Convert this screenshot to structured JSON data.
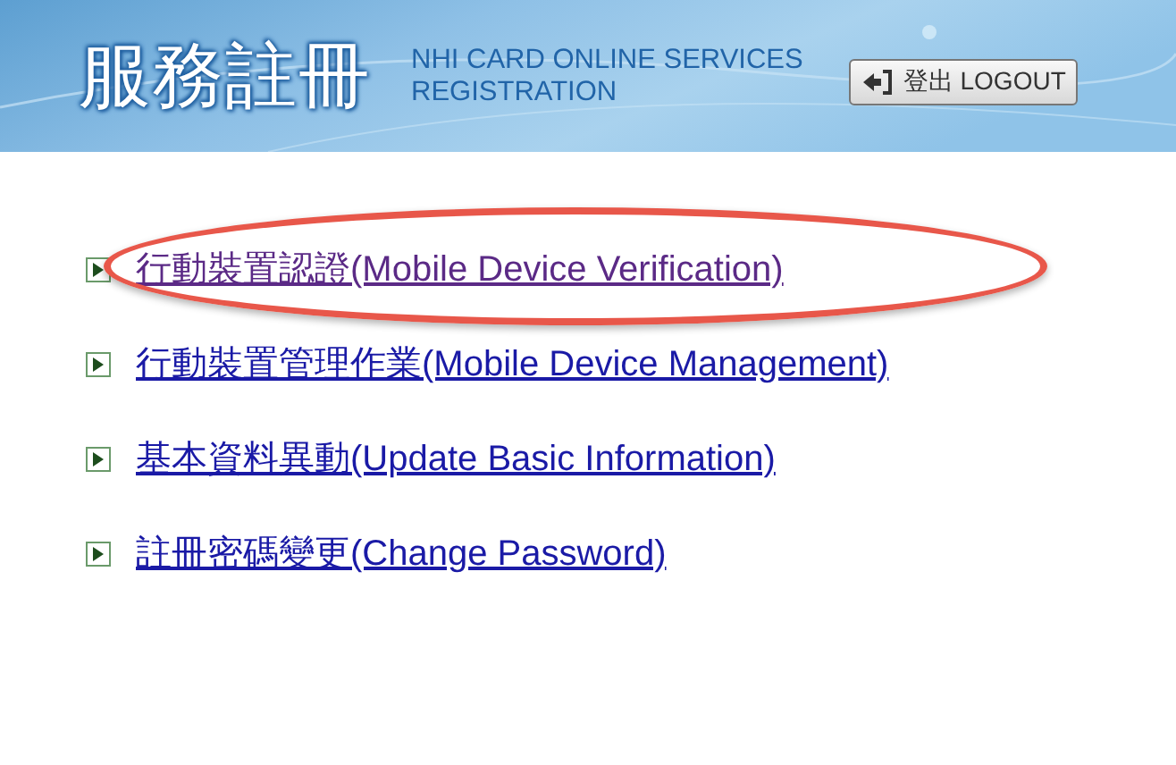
{
  "header": {
    "title": "服務註冊",
    "subtitle_lines": [
      "NHI CARD ONLINE SERVICES",
      "REGISTRATION"
    ],
    "logout_button": "登出 LOGOUT"
  },
  "links": [
    {
      "label": "行動裝置認證(Mobile Device Verification)",
      "visited": true,
      "circled": true
    },
    {
      "label": "行動裝置管理作業(Mobile Device Management)",
      "visited": false,
      "circled": false
    },
    {
      "label": "基本資料異動(Update Basic Information)",
      "visited": false,
      "circled": false
    },
    {
      "label": "註冊密碼變更(Change Password)",
      "visited": false,
      "circled": false
    }
  ]
}
